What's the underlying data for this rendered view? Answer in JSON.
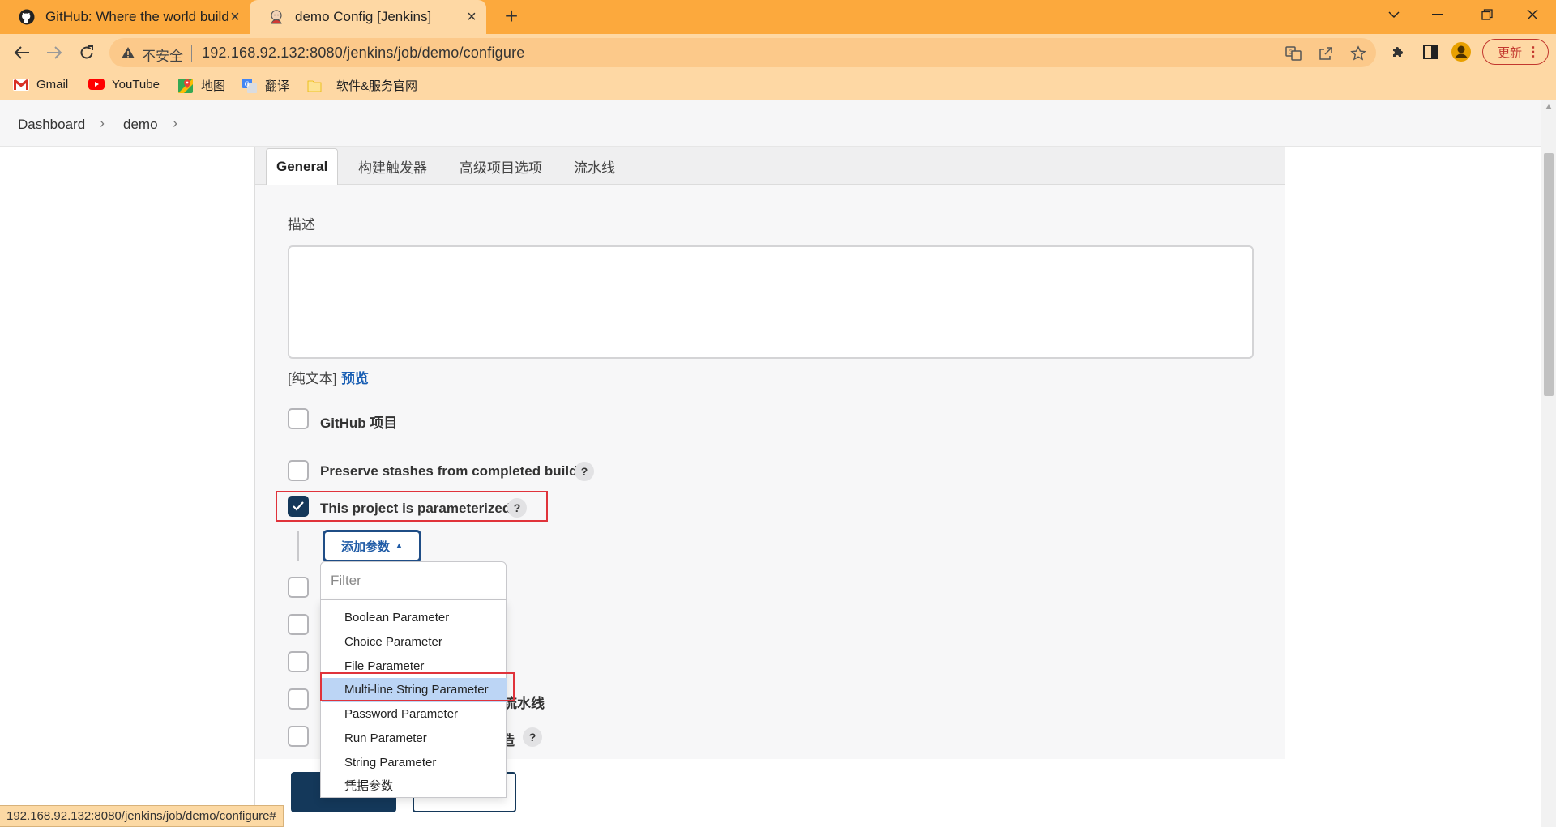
{
  "browser": {
    "tabs": [
      {
        "title": "GitHub: Where the world build",
        "icon": "github-icon",
        "active": false
      },
      {
        "title": "demo Config [Jenkins]",
        "icon": "jenkins-icon",
        "active": true
      }
    ],
    "address": {
      "security_label": "不安全",
      "url": "192.168.92.132:8080/jenkins/job/demo/configure"
    },
    "update_label": "更新",
    "bookmarks": [
      {
        "label": "Gmail",
        "icon": "gmail-icon"
      },
      {
        "label": "YouTube",
        "icon": "youtube-icon"
      },
      {
        "label": "地图",
        "icon": "maps-icon"
      },
      {
        "label": "翻译",
        "icon": "translate-icon"
      },
      {
        "label": "软件&服务官网",
        "icon": "folder-icon"
      }
    ],
    "status_url": "192.168.92.132:8080/jenkins/job/demo/configure#"
  },
  "breadcrumb": {
    "items": [
      "Dashboard",
      "demo"
    ]
  },
  "config": {
    "tabs": [
      "General",
      "构建触发器",
      "高级项目选项",
      "流水线"
    ],
    "description": {
      "label": "描述",
      "value": "",
      "plain_text": "[纯文本]",
      "preview": "预览"
    },
    "options": [
      {
        "label": "GitHub 项目",
        "checked": false,
        "help": false
      },
      {
        "label": "Preserve stashes from completed builds",
        "checked": false,
        "help": true
      },
      {
        "label": "This project is parameterized",
        "checked": true,
        "help": true
      }
    ],
    "partially_hidden_options": [
      {
        "label_visible": "流水线"
      },
      {
        "label_visible": "造"
      }
    ],
    "help_glyph": "?",
    "add_parameter": {
      "label": "添加参数",
      "filter_placeholder": "Filter",
      "items": [
        "Boolean Parameter",
        "Choice Parameter",
        "File Parameter",
        "Multi-line String Parameter",
        "Password Parameter",
        "Run Parameter",
        "String Parameter",
        "凭据参数"
      ],
      "highlighted_item": "Multi-line String Parameter"
    }
  },
  "colors": {
    "tab_bar": "#fca93d",
    "toolbar": "#fed8a4",
    "accent_blue": "#1f4d86",
    "highlight_red": "#e0333b",
    "checkbox_checked": "#14385a"
  }
}
